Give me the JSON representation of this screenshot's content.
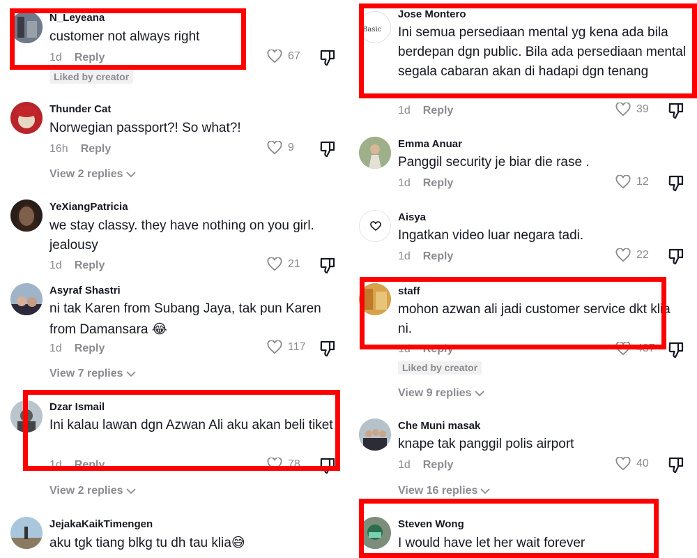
{
  "left": {
    "comments": [
      {
        "user": "N_Leyeana",
        "text": "customer not always right",
        "time": "1d",
        "reply": "Reply",
        "likes": "67",
        "badge": "Liked by creator"
      },
      {
        "user": "Thunder Cat",
        "text": "Norwegian passport?! So what?!",
        "time": "16h",
        "reply": "Reply",
        "likes": "9",
        "view_replies": "View 2 replies"
      },
      {
        "user": "YeXiangPatricia",
        "text": "we stay classy. they have nothing on you girl. jealousy",
        "time": "1d",
        "reply": "Reply",
        "likes": "21"
      },
      {
        "user": "Asyraf Shastri",
        "text": "ni tak Karen from Subang Jaya, tak pun Karen from Damansara 😂",
        "time": "1d",
        "reply": "Reply",
        "likes": "117",
        "view_replies": "View 7 replies"
      },
      {
        "user": "Dzar Ismail",
        "text": "Ini kalau lawan dgn Azwan Ali aku akan beli tiket",
        "time": "1d",
        "reply": "Reply",
        "likes": "78",
        "view_replies": "View 2 replies"
      },
      {
        "user": "JejakaKaikTimengen",
        "text": "aku tgk tiang blkg tu dh tau klia😅"
      }
    ]
  },
  "right": {
    "comments": [
      {
        "user": "Jose Montero",
        "text": "Ini semua persediaan mental yg kena ada bila berdepan dgn public. Bila ada persediaan mental segala cabaran akan di hadapi dgn tenang",
        "time": "1d",
        "reply": "Reply",
        "likes": "39"
      },
      {
        "user": "Emma Anuar",
        "text": "Panggil security je biar die rase .",
        "time": "1d",
        "reply": "Reply",
        "likes": "12"
      },
      {
        "user": "Aisya",
        "text": "Ingatkan video luar negara tadi.",
        "time": "1d",
        "reply": "Reply",
        "likes": "22"
      },
      {
        "user": "staff",
        "text": "mohon azwan ali jadi customer service dkt klia ni.",
        "time": "1d",
        "reply": "Reply",
        "likes": "437",
        "badge": "Liked by creator",
        "view_replies": "View 9 replies"
      },
      {
        "user": "Che Muni masak",
        "text": "knape tak panggil polis airport",
        "time": "1d",
        "reply": "Reply",
        "likes": "40",
        "view_replies": "View 16 replies"
      },
      {
        "user": "Steven Wong",
        "text": "I would have let her wait forever"
      }
    ]
  },
  "icons": {
    "like": "heart-outline-icon",
    "dislike": "thumbs-down-icon",
    "chevron": "chevron-down-icon"
  },
  "colors": {
    "highlight_box": "#ff0000",
    "muted": "#8a8b91",
    "text": "#161823"
  }
}
